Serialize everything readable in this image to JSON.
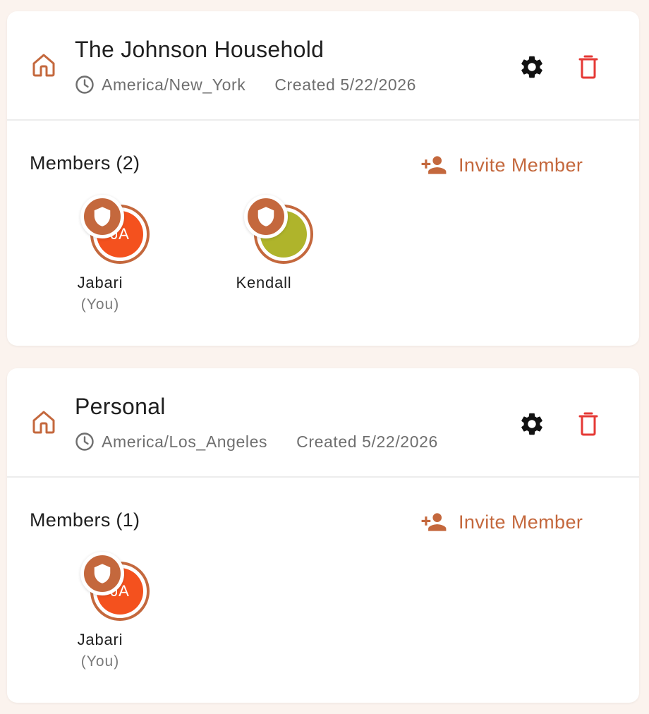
{
  "colors": {
    "accent": "#c4683d",
    "danger": "#e53935",
    "background": "#fbf3ee",
    "card": "#ffffff"
  },
  "households": [
    {
      "name": "The Johnson Household",
      "timezone": "America/New_York",
      "created": "Created 5/22/2026",
      "members_label": "Members (2)",
      "invite_label": "Invite Member",
      "icons": [
        "home-icon",
        "clock-icon",
        "gear-icon",
        "trash-icon",
        "person-add-icon"
      ],
      "members": [
        {
          "initials": "JA",
          "name": "Jabari",
          "note": "(You)",
          "color": "#f4511e",
          "badge_icon": "shield-icon"
        },
        {
          "initials": "",
          "name": "Kendall",
          "note": "",
          "color": "#afb42b",
          "badge_icon": "shield-icon"
        }
      ]
    },
    {
      "name": "Personal",
      "timezone": "America/Los_Angeles",
      "created": "Created 5/22/2026",
      "members_label": "Members (1)",
      "invite_label": "Invite Member",
      "icons": [
        "home-icon",
        "clock-icon",
        "gear-icon",
        "trash-icon",
        "person-add-icon"
      ],
      "members": [
        {
          "initials": "JA",
          "name": "Jabari",
          "note": "(You)",
          "color": "#f4511e",
          "badge_icon": "shield-icon"
        }
      ]
    }
  ]
}
